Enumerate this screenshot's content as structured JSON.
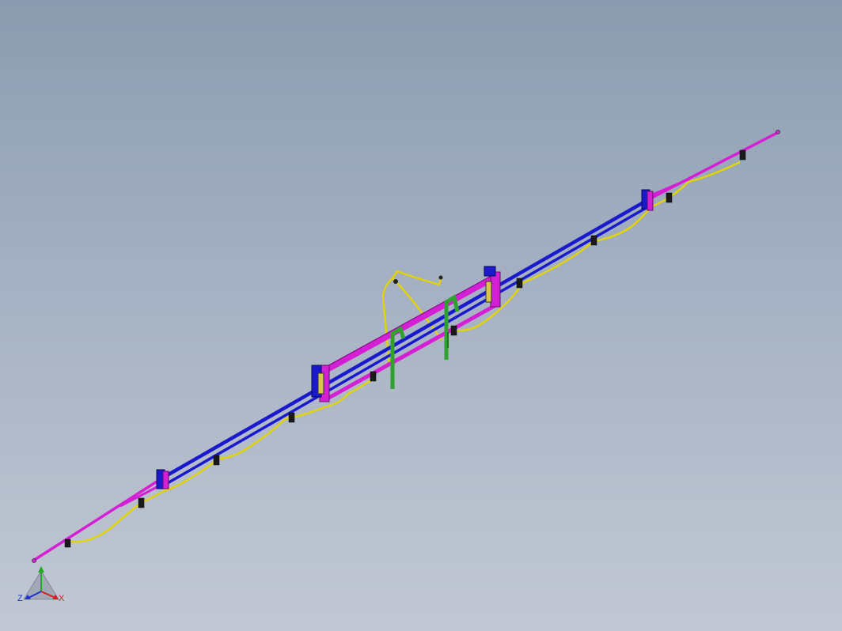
{
  "viewport": {
    "background_top": "#8b9cb0",
    "background_bottom": "#c2c8d4"
  },
  "model": {
    "colors": {
      "main_beam": "#1a1acc",
      "frame": "#d51fd5",
      "hose": "#e2d400",
      "bracket": "#2ea12e",
      "nozzle": "#1a1a1a"
    }
  },
  "triad": {
    "axis_z": "Z",
    "axis_x": "X",
    "colors": {
      "x": "#d42020",
      "y": "#22aa22",
      "z": "#2233cc"
    }
  }
}
